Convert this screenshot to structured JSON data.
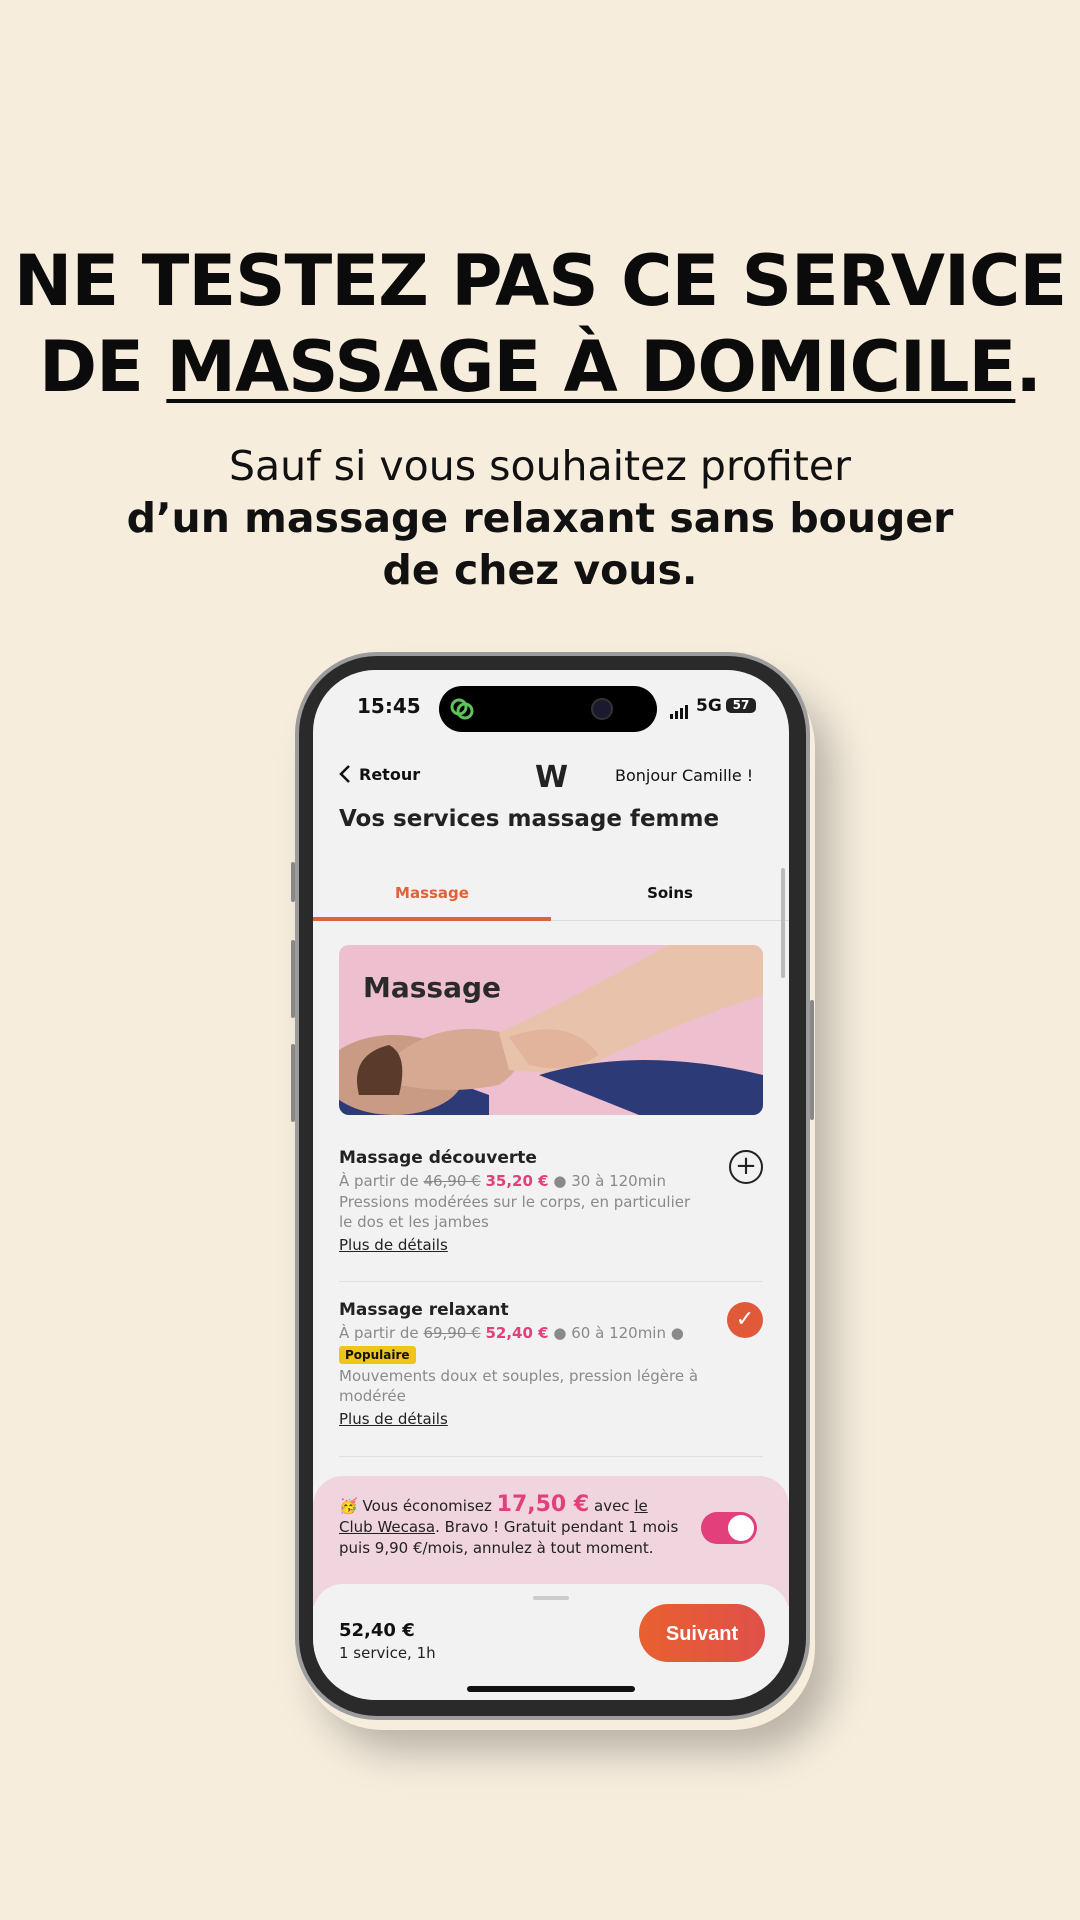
{
  "headline": {
    "line1": "NE TESTEZ PAS CE SERVICE",
    "line2_prefix": "DE ",
    "line2_underlined": "MASSAGE À DOMICILE",
    "line2_suffix": "."
  },
  "subheadline": {
    "line1": "Sauf si vous souhaitez profiter",
    "line2": "d’un massage relaxant sans bouger",
    "line3": "de chez vous."
  },
  "status_bar": {
    "time": "15:45",
    "network": "5G",
    "battery": "57"
  },
  "nav": {
    "back_label": "Retour",
    "logo": "W",
    "greeting": "Bonjour Camille !"
  },
  "page_title": "Vos services massage femme",
  "tabs": [
    {
      "label": "Massage",
      "active": true
    },
    {
      "label": "Soins",
      "active": false
    }
  ],
  "hero": {
    "title": "Massage"
  },
  "services": [
    {
      "name": "Massage découverte",
      "prefix": "À partir de",
      "old_price": "46,90 €",
      "new_price": "35,20 €",
      "duration": "30 à 120min",
      "badge": "",
      "description": "Pressions modérées sur le corps, en particulier le dos et les jambes",
      "details_link": "Plus de détails",
      "selected": false
    },
    {
      "name": "Massage relaxant",
      "prefix": "À partir de",
      "old_price": "69,90 €",
      "new_price": "52,40 €",
      "duration": "60 à 120min",
      "badge": "Populaire",
      "description": "Mouvements doux et souples, pression légère à modérée",
      "details_link": "Plus de détails",
      "selected": true
    }
  ],
  "club": {
    "emoji": "🥳",
    "text_before": "Vous économisez",
    "amount": "17,50 €",
    "text_avec": "avec",
    "link": "le Club Wecasa",
    "text_after": ". Bravo ! Gratuit pendant 1 mois puis 9,90 €/mois, annulez à tout moment.",
    "toggle_on": true
  },
  "footer": {
    "total": "52,40 €",
    "summary": "1 service, 1h",
    "next_label": "Suivant"
  },
  "colors": {
    "background": "#f6eddd",
    "accent": "#e0623a",
    "pink": "#e2407b",
    "badge": "#f0c419"
  }
}
